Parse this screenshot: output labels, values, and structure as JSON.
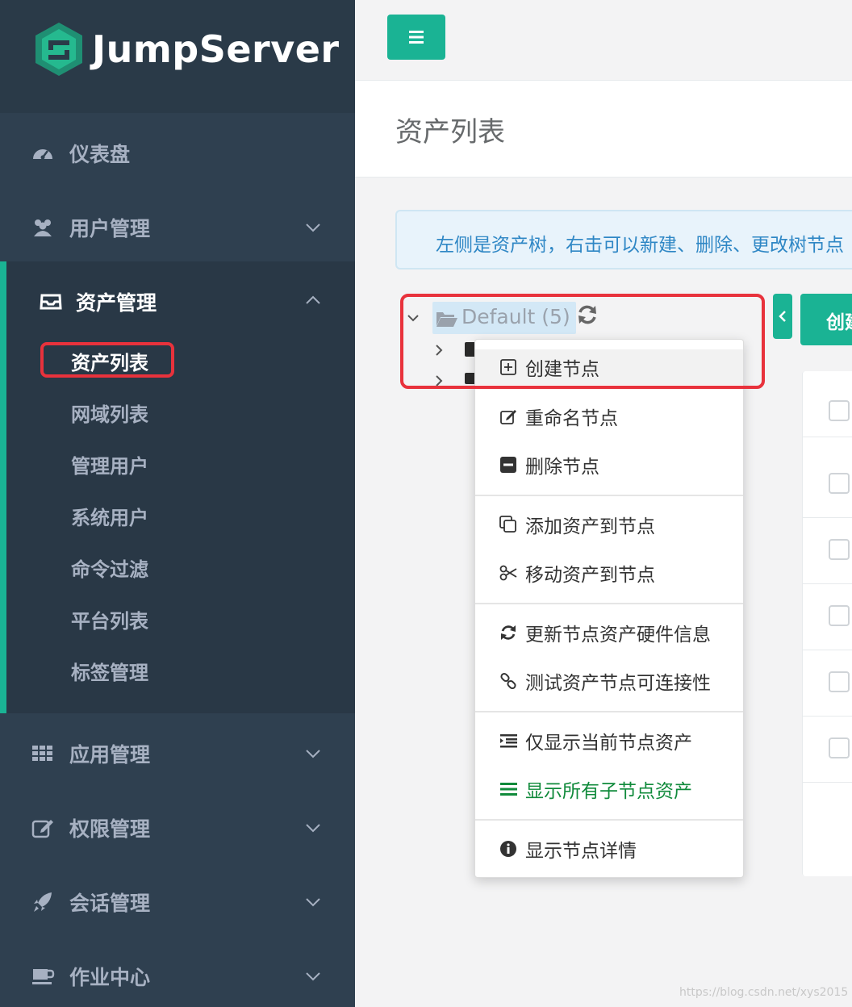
{
  "brand": {
    "name": "JumpServer"
  },
  "sidebar": {
    "items": [
      {
        "label": "仪表盘",
        "icon": "dashboard-icon"
      },
      {
        "label": "用户管理",
        "icon": "users-icon"
      },
      {
        "label": "资产管理",
        "icon": "inbox-icon"
      },
      {
        "label": "应用管理",
        "icon": "grid-icon"
      },
      {
        "label": "权限管理",
        "icon": "edit-icon"
      },
      {
        "label": "会话管理",
        "icon": "rocket-icon"
      },
      {
        "label": "作业中心",
        "icon": "coffee-icon"
      }
    ],
    "asset_submenu": [
      "资产列表",
      "网域列表",
      "管理用户",
      "系统用户",
      "命令过滤",
      "平台列表",
      "标签管理"
    ]
  },
  "header": {
    "title": "资产列表"
  },
  "alert": {
    "text": "左侧是资产树，右击可以新建、删除、更改树节点"
  },
  "tree": {
    "root_label": "Default (5)"
  },
  "buttons": {
    "create": "创建"
  },
  "context_menu": {
    "items": [
      "创建节点",
      "重命名节点",
      "删除节点",
      "添加资产到节点",
      "移动资产到节点",
      "更新节点资产硬件信息",
      "测试资产节点可连接性",
      "仅显示当前节点资产",
      "显示所有子节点资产",
      "显示节点详情"
    ]
  },
  "watermark": "https://blog.csdn.net/xys2015",
  "colors": {
    "accent": "#1ab394",
    "sidebar": "#2f4050",
    "highlight": "#e8323c",
    "info": "#2f87c5"
  }
}
